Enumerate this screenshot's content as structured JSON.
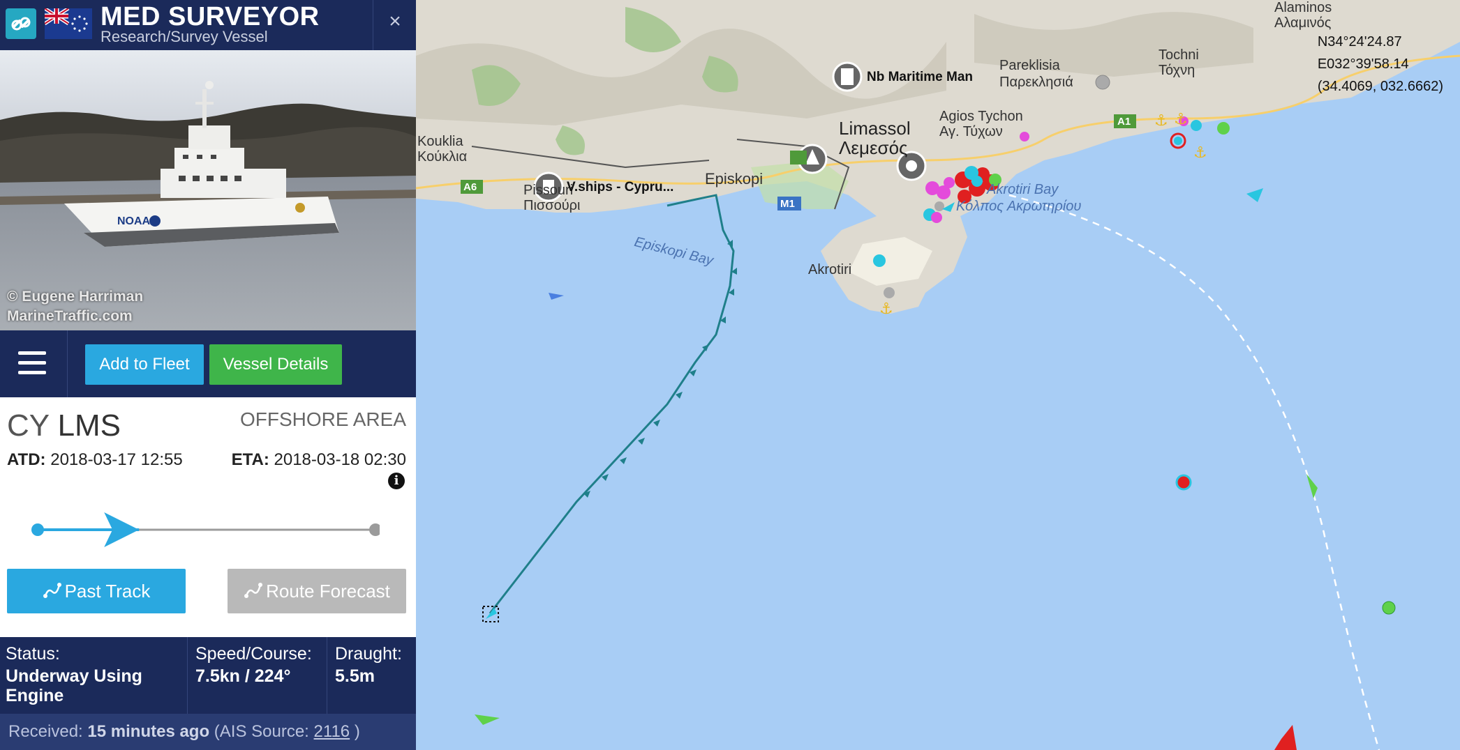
{
  "header": {
    "vessel_name": "MED SURVEYOR",
    "vessel_type": "Research/Survey Vessel",
    "close": "×",
    "logo_icon": "marinetraffic-logo-icon",
    "flag_icon": "cook-islands-flag-icon"
  },
  "photo": {
    "credit_line1": "© Eugene Harriman",
    "credit_line2": "MarineTraffic.com"
  },
  "toolbar": {
    "add_fleet": "Add to Fleet",
    "vessel_details": "Vessel Details"
  },
  "voyage": {
    "departure_country": "CY",
    "departure_port": "LMS",
    "destination": "OFFSHORE AREA",
    "atd_label": "ATD:",
    "atd_value": "2018-03-17 12:55",
    "eta_label": "ETA:",
    "eta_value": "2018-03-18 02:30",
    "progress": 0.3
  },
  "buttons": {
    "past_track": "Past Track",
    "route_forecast": "Route Forecast"
  },
  "status": {
    "status_label": "Status:",
    "status_line1": "Underway Using",
    "status_line2": "Engine",
    "speed_label": "Speed/Course:",
    "speed_value": "7.5kn / 224°",
    "draught_label": "Draught:",
    "draught_value": "5.5m"
  },
  "received": {
    "label": "Received:",
    "value": "15 minutes ago",
    "source_label": "(AIS Source:",
    "source_value": "2116",
    "source_close": ")"
  },
  "map": {
    "coord_lat": "N34°24'24.87",
    "coord_lon": "E032°39'58.14",
    "coord_dec": "(34.4069, 032.6662)",
    "labels": {
      "alaminos": "Alaminos",
      "alaminos_gr": "Αλαμινός",
      "tochni": "Tochni",
      "tochni_gr": "Τόχνη",
      "pareklisia": "Pareklisia",
      "pareklisia_gr": "Παρεκλησιά",
      "agios_tychon": "Agios Tychon",
      "agios_tychon_gr": "Αγ. Τύχων",
      "limassol": "Limassol",
      "limassol_gr": "Λεμεσός",
      "kouklia": "Kouklia",
      "kouklia_gr": "Κούκλια",
      "episkopi": "Episkopi",
      "pissouri": "Pissouri",
      "pissouri_gr": "Πισσούρι",
      "akrotiri": "Akrotiri",
      "episkopi_bay": "Episkopi Bay",
      "akrotiri_bay": "Akrotiri Bay",
      "akrotiri_bay_gr": "Κόλπος Ακρωτηρίου",
      "nb_maritime": "Nb Maritime Man",
      "vships": "V.ships - Cypru...",
      "road_a1": "A1",
      "road_a6": "A6",
      "road_m1": "M1"
    }
  }
}
